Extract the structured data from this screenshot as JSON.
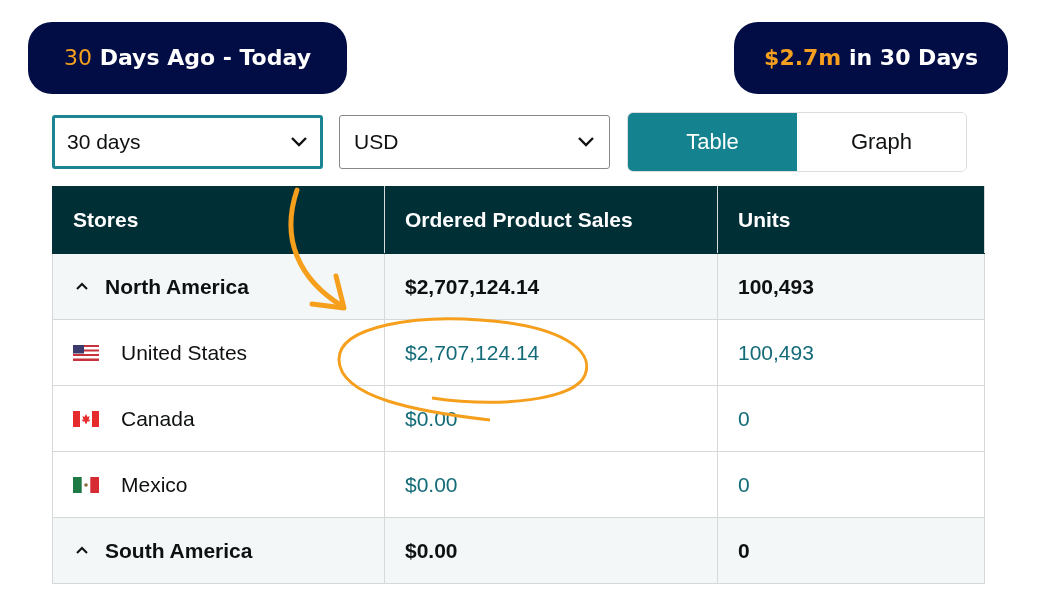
{
  "badges": [
    {
      "highlight": "30",
      "highlight_bold": false,
      "text": "Days Ago - Today"
    },
    {
      "highlight": "$2.7m",
      "highlight_bold": true,
      "text": "in 30 Days"
    }
  ],
  "filters": [
    {
      "value": "30 days",
      "focused": true
    },
    {
      "value": "USD",
      "focused": false
    }
  ],
  "view_tabs": [
    {
      "label": "Table",
      "selected": true
    },
    {
      "label": "Graph",
      "selected": false
    }
  ],
  "table": {
    "columns": [
      "Stores",
      "Ordered Product Sales",
      "Units"
    ],
    "rows": [
      {
        "name": "North America",
        "sales": "$2,707,124.14",
        "units": "100,493",
        "expanded": true,
        "children": [
          {
            "name": "United States",
            "sales": "$2,707,124.14",
            "units": "100,493"
          },
          {
            "name": "Canada",
            "sales": "$0.00",
            "units": "0"
          },
          {
            "name": "Mexico",
            "sales": "$0.00",
            "units": "0"
          }
        ]
      },
      {
        "name": "South America",
        "sales": "$0.00",
        "units": "0",
        "expanded": true
      }
    ]
  }
}
